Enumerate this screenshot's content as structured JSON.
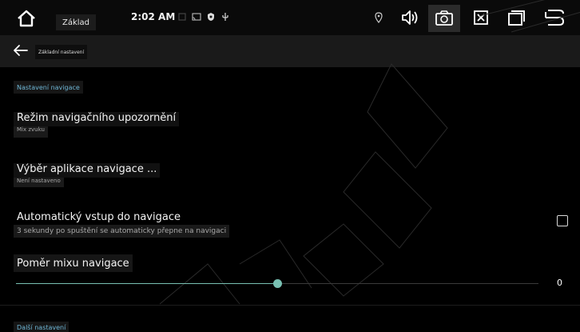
{
  "statusbar": {
    "home_label": "Základ",
    "time": "2:02 AM"
  },
  "header": {
    "title": "Základní nastavení"
  },
  "sections": {
    "navigation": {
      "label": "Nastavení navigace"
    },
    "other": {
      "label": "Další nastavení"
    }
  },
  "items": {
    "nav_alert": {
      "title": "Režim navigačního upozornění",
      "subtitle": "Mix zvuku"
    },
    "nav_app": {
      "title": "Výběr aplikace navigace ...",
      "subtitle": "Není nastaveno"
    },
    "auto_nav": {
      "title": "Automatický vstup do navigace",
      "subtitle": "3 sekundy po spuštění se automaticky přepne na navigaci",
      "checked": false
    },
    "mix_ratio": {
      "title": "Poměr mixu navigace",
      "value": "0",
      "level": 0.5
    }
  },
  "colors": {
    "accent": "#6fb7d6",
    "slider": "#78c0b2",
    "background": "#000000"
  },
  "icons": [
    "home-icon",
    "cast-icon",
    "shield-icon",
    "usb-icon",
    "location-icon",
    "volume-icon",
    "screenshot-icon",
    "close-window-icon",
    "recent-apps-icon",
    "back-icon",
    "arrow-left-icon"
  ]
}
